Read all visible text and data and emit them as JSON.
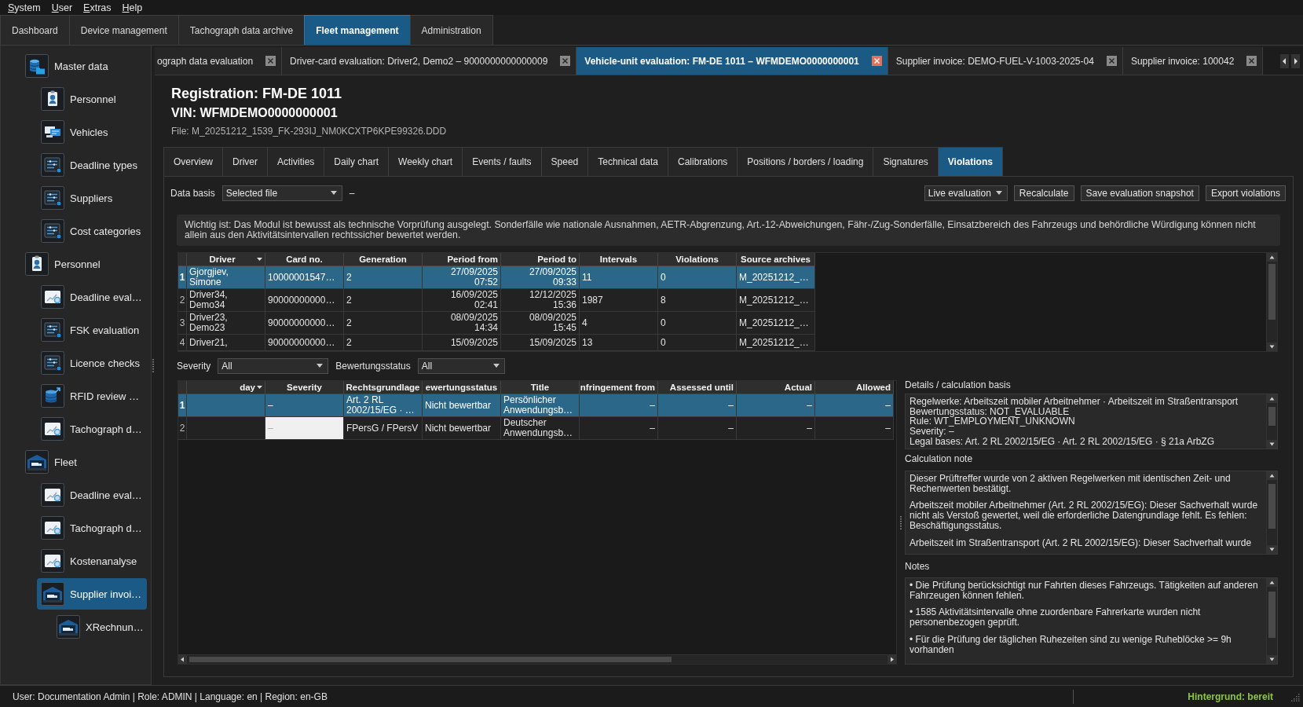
{
  "menu_bar": [
    {
      "label": "System"
    },
    {
      "label": "User"
    },
    {
      "label": "Extras"
    },
    {
      "label": "Help"
    }
  ],
  "main_tabs": [
    {
      "label": "Dashboard",
      "selected": false
    },
    {
      "label": "Device management",
      "selected": false
    },
    {
      "label": "Tachograph data archive",
      "selected": false
    },
    {
      "label": "Fleet management",
      "selected": true
    },
    {
      "label": "Administration",
      "selected": false
    }
  ],
  "sidebar": {
    "items": [
      {
        "label": "Master data",
        "kind": "database",
        "selected": false,
        "children": [
          {
            "label": "Personnel",
            "kind": "badge",
            "selected": false
          },
          {
            "label": "Vehicles",
            "kind": "screens",
            "selected": false
          },
          {
            "label": "Deadline types",
            "kind": "sliders",
            "selected": false
          },
          {
            "label": "Suppliers",
            "kind": "sliders",
            "selected": false
          },
          {
            "label": "Cost categories",
            "kind": "sliders",
            "selected": false
          }
        ]
      },
      {
        "label": "Personnel",
        "kind": "badge",
        "selected": false,
        "children": [
          {
            "label": "Deadline eval…",
            "kind": "chart",
            "selected": false
          },
          {
            "label": "FSK evaluation",
            "kind": "sliders",
            "selected": false
          },
          {
            "label": "Licence checks",
            "kind": "sliders",
            "selected": false
          },
          {
            "label": "RFID review …",
            "kind": "upload",
            "selected": false
          },
          {
            "label": "Tachograph d…",
            "kind": "chart",
            "selected": false
          }
        ]
      },
      {
        "label": "Fleet",
        "kind": "garage",
        "selected": false,
        "children": [
          {
            "label": "Deadline eval…",
            "kind": "chart",
            "selected": false
          },
          {
            "label": "Tachograph d…",
            "kind": "chart",
            "selected": false
          },
          {
            "label": "Kostenanalyse",
            "kind": "chart",
            "selected": false
          },
          {
            "label": "Supplier invoi…",
            "kind": "garage",
            "selected": true,
            "children": [
              {
                "label": "XRechnun…",
                "kind": "garage",
                "selected": false
              }
            ]
          }
        ]
      }
    ]
  },
  "document_tabs": [
    {
      "label": "ograph data evaluation",
      "selected": false
    },
    {
      "label": "Driver-card evaluation: Driver2, Demo2 – 9000000000000009",
      "selected": false
    },
    {
      "label": "Vehicle-unit evaluation: FM-DE 1011 – WFMDEMO0000000001",
      "selected": true
    },
    {
      "label": "Supplier invoice: DEMO-FUEL-V-1003-2025-04",
      "selected": false
    },
    {
      "label": "Supplier invoice: 100042",
      "selected": false
    }
  ],
  "header": {
    "registration": "Registration: FM-DE 1011",
    "vin": "VIN: WFMDEMO0000000001",
    "file": "File: M_20251212_1539_FK-293IJ_NM0KCXTP6KPE99326.DDD"
  },
  "view_tabs": [
    {
      "label": "Overview",
      "selected": false
    },
    {
      "label": "Driver",
      "selected": false
    },
    {
      "label": "Activities",
      "selected": false
    },
    {
      "label": "Daily chart",
      "selected": false
    },
    {
      "label": "Weekly chart",
      "selected": false
    },
    {
      "label": "Events / faults",
      "selected": false
    },
    {
      "label": "Speed",
      "selected": false
    },
    {
      "label": "Technical data",
      "selected": false
    },
    {
      "label": "Calibrations",
      "selected": false
    },
    {
      "label": "Positions / borders / loading",
      "selected": false
    },
    {
      "label": "Signatures",
      "selected": false
    },
    {
      "label": "Violations",
      "selected": true
    }
  ],
  "toolbar": {
    "data_basis": {
      "label": "Data basis",
      "value": "Selected file"
    },
    "data_basis_info": "–",
    "evaluation_mode": "Live evaluation",
    "buttons": [
      "Recalculate",
      "Save evaluation snapshot",
      "Export violations"
    ]
  },
  "notice": "Wichtig ist: Das Modul ist bewusst als technische Vorprüfung ausgelegt. Sonderfälle wie nationale Ausnahmen, AETR-Abgrenzung, Art.-12-Abweichungen, Fähr-/Zug-Sonderfälle, Einsatzbereich des Fahrzeugs und behördliche Würdigung können nicht allein aus den Aktivitätsintervallen rechtssicher bewertet werden.",
  "drivers_table": {
    "columns": [
      {
        "label": "Driver",
        "kind": "text",
        "sorted": true
      },
      {
        "label": "Card no.",
        "kind": "text",
        "sorted": false
      },
      {
        "label": "Generation",
        "kind": "text",
        "sorted": false
      },
      {
        "label": "Period from",
        "kind": "value",
        "sorted": false
      },
      {
        "label": "Period to",
        "kind": "value",
        "sorted": false
      },
      {
        "label": "Intervals",
        "kind": "text",
        "sorted": false
      },
      {
        "label": "Violations",
        "kind": "text",
        "sorted": false
      },
      {
        "label": "Source archives",
        "kind": "text",
        "sorted": false
      }
    ],
    "rows": [
      {
        "number": "1",
        "selected": true,
        "cells": [
          "Gjorgjiev,\nSimone",
          "10000001547…",
          "2",
          "27/09/2025\n07:52",
          "27/09/2025\n09:33",
          "11",
          "0",
          "M_20251212_…"
        ]
      },
      {
        "number": "2",
        "selected": false,
        "cells": [
          "Driver34,\nDemo34",
          "90000000000…",
          "2",
          "16/09/2025\n02:41",
          "12/12/2025\n15:36",
          "1987",
          "8",
          "M_20251212_…"
        ]
      },
      {
        "number": "3",
        "selected": false,
        "cells": [
          "Driver23,\nDemo23",
          "90000000000…",
          "2",
          "08/09/2025\n14:34",
          "08/09/2025\n15:45",
          "4",
          "0",
          "M_20251212_…"
        ]
      },
      {
        "number": "4",
        "selected": false,
        "cells": [
          "Driver21,",
          "90000000000…",
          "2",
          "15/09/2025",
          "15/09/2025",
          "13",
          "0",
          "M_20251212_…"
        ]
      }
    ]
  },
  "filters": [
    {
      "label": "Severity",
      "value": "All"
    },
    {
      "label": "Bewertungsstatus",
      "value": "All"
    }
  ],
  "violations_table": {
    "columns": [
      {
        "label": "day",
        "kind": "value",
        "sorted": true
      },
      {
        "label": "Severity",
        "kind": "severity",
        "sorted": false
      },
      {
        "label": "Rechtsgrundlage",
        "kind": "text",
        "sorted": false
      },
      {
        "label": "ewertungsstatus",
        "kind": "text",
        "sorted": false
      },
      {
        "label": "Title",
        "kind": "text",
        "sorted": false
      },
      {
        "label": "nfringement from",
        "kind": "value",
        "sorted": false
      },
      {
        "label": "Assessed until",
        "kind": "value",
        "sorted": false
      },
      {
        "label": "Actual",
        "kind": "value",
        "sorted": false
      },
      {
        "label": "Allowed",
        "kind": "value",
        "sorted": false
      }
    ],
    "rows": [
      {
        "number": "1",
        "selected": true,
        "cells": [
          null,
          "–",
          "Art. 2 RL\n2002/15/EG · …",
          "Nicht bewertbar",
          "Persönlicher\nAnwendungsb…",
          "–",
          "–",
          "–",
          "–"
        ]
      },
      {
        "number": "2",
        "selected": false,
        "color": "#f0f0f0",
        "cells": [
          null,
          "–",
          "FPersG / FPersV",
          "Nicht bewertbar",
          "Deutscher\nAnwendungsb…",
          "–",
          "–",
          "–",
          "–"
        ]
      }
    ]
  },
  "details": {
    "label": "Details / calculation basis",
    "lines": [
      "Regelwerke: Arbeitszeit mobiler Arbeitnehmer · Arbeitszeit im Straßentransport",
      "Bewertungsstatus: NOT_EVALUABLE",
      "Rule: WT_EMPLOYMENT_UNKNOWN",
      "Severity: –",
      "Legal bases: Art. 2 RL 2002/15/EG · Art. 2 RL 2002/15/EG · § 21a ArbZG"
    ]
  },
  "calculation_note": {
    "label": "Calculation note",
    "paragraphs": [
      "Dieser Prüftreffer wurde von 2 aktiven Regelwerken mit identischen Zeit- und Rechenwerten bestätigt.",
      "Arbeitszeit mobiler Arbeitnehmer (Art. 2 RL 2002/15/EG): Dieser Sachverhalt wurde nicht als Verstoß gewertet, weil die erforderliche Datengrundlage fehlt. Es fehlen: Beschäftigungsstatus.",
      "Arbeitszeit im Straßentransport (Art. 2 RL 2002/15/EG): Dieser Sachverhalt wurde"
    ]
  },
  "notes": {
    "label": "Notes",
    "paragraphs": [
      "• Die Prüfung berücksichtigt nur Fahrten dieses Fahrzeugs. Tätigkeiten auf anderen Fahrzeugen können fehlen.",
      "• 1585 Aktivitätsintervalle ohne zuordenbare Fahrerkarte wurden nicht personenbezogen geprüft.",
      "• Für die Prüfung der täglichen Ruhezeiten sind zu wenige Ruheblöcke >= 9h vorhanden"
    ]
  },
  "status_bar": {
    "text": "User: Documentation Admin | Role: ADMIN | Language: en | Region: en-GB",
    "background_status": "Hintergrund: bereit"
  }
}
